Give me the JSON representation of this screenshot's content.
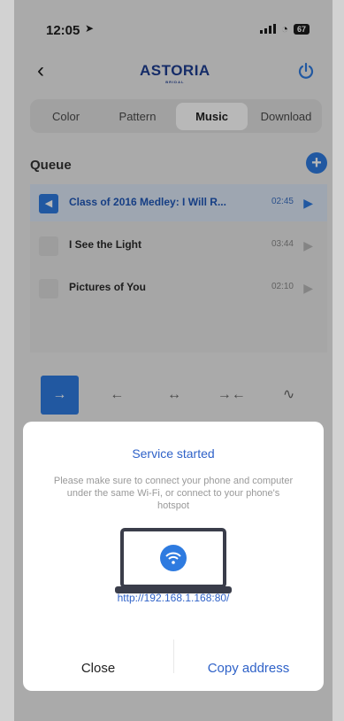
{
  "status": {
    "time": "12:05",
    "battery": "67"
  },
  "nav": {
    "logo": "ASTORIA",
    "logo_sub": "BRIDAL"
  },
  "tabs": [
    {
      "label": "Color",
      "active": false
    },
    {
      "label": "Pattern",
      "active": false
    },
    {
      "label": "Music",
      "active": true
    },
    {
      "label": "Download",
      "active": false
    }
  ],
  "queue": {
    "label": "Queue",
    "tracks": [
      {
        "title": "Class of 2016 Medley: I Will R...",
        "duration": "02:45",
        "playing": true
      },
      {
        "title": "I See the Light",
        "duration": "03:44",
        "playing": false
      },
      {
        "title": "Pictures of You",
        "duration": "02:10",
        "playing": false
      }
    ]
  },
  "directions": [
    {
      "icon": "arrow-right-icon",
      "glyph": "→",
      "active": true
    },
    {
      "icon": "arrow-left-icon",
      "glyph": "←",
      "active": false
    },
    {
      "icon": "arrow-both-icon",
      "glyph": "↔",
      "active": false
    },
    {
      "icon": "arrow-converge-icon",
      "glyph": "→←",
      "active": false
    },
    {
      "icon": "wave-icon",
      "glyph": "∿",
      "active": false
    }
  ],
  "modal": {
    "title": "Service started",
    "message": "Please make sure to connect your phone and computer under the same Wi-Fi, or connect to your phone's hotspot",
    "address": "http://192.168.1.168:80/",
    "close_label": "Close",
    "copy_label": "Copy address"
  },
  "colors": {
    "accent": "#2e7be0",
    "brand_blue": "#1e3d91",
    "brand_red": "#d34a3c"
  }
}
